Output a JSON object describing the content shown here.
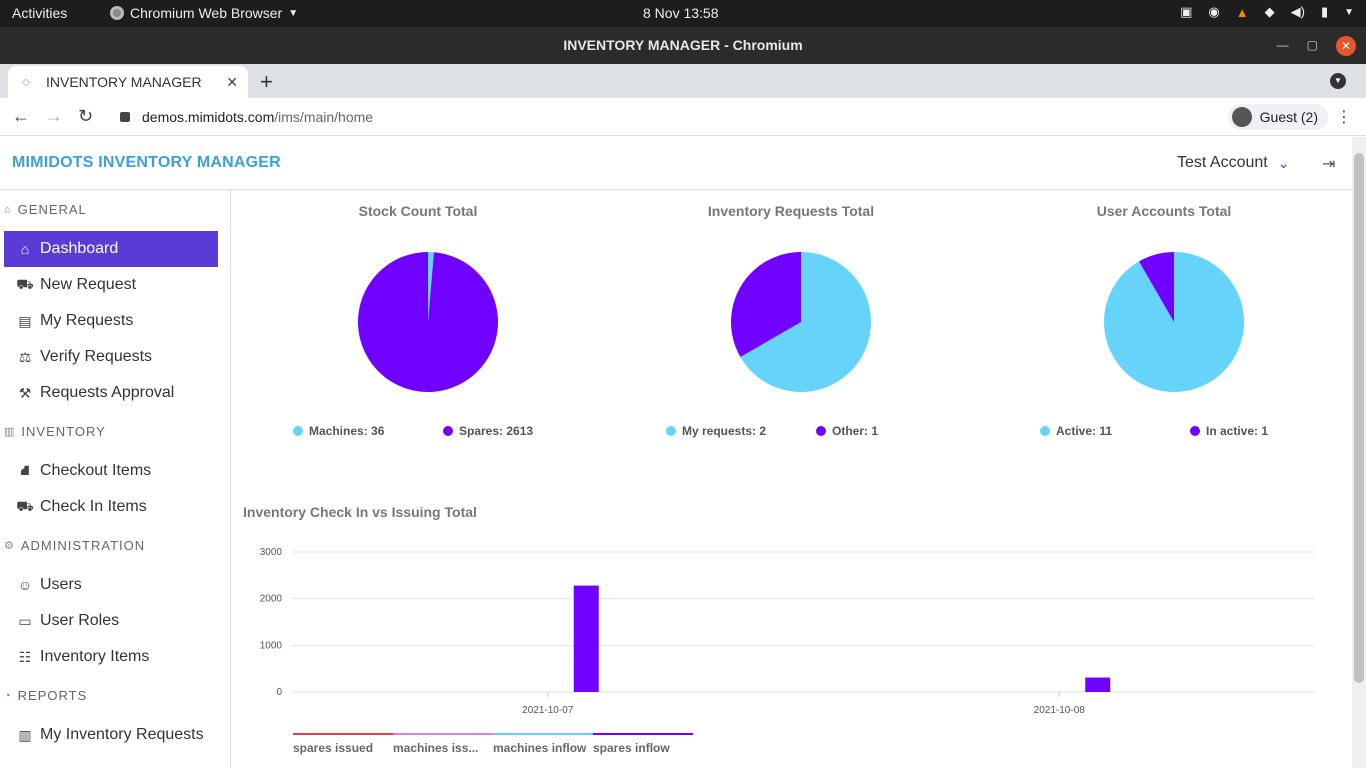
{
  "os": {
    "activities": "Activities",
    "app_name": "Chromium Web Browser",
    "clock": "8 Nov  13:58"
  },
  "window": {
    "title": "INVENTORY MANAGER - Chromium"
  },
  "browser": {
    "tab_title": "INVENTORY MANAGER",
    "url_host": "demos.mimidots.com",
    "url_path": "/ims/main/home",
    "profile": "Guest (2)"
  },
  "app": {
    "brand": "MIMIDOTS INVENTORY MANAGER",
    "account": "Test Account"
  },
  "sidebar": {
    "sections": [
      {
        "label": "GENERAL",
        "icon": "bank-icon"
      },
      {
        "label": "INVENTORY",
        "icon": "warehouse-icon"
      },
      {
        "label": "ADMINISTRATION",
        "icon": "gears-icon"
      },
      {
        "label": "REPORTS",
        "icon": "pie-icon"
      }
    ],
    "items": [
      {
        "label": "Dashboard",
        "icon": "home-icon",
        "active": true
      },
      {
        "label": "New Request",
        "icon": "cart-icon"
      },
      {
        "label": "My Requests",
        "icon": "archive-icon"
      },
      {
        "label": "Verify Requests",
        "icon": "scale-icon"
      },
      {
        "label": "Requests Approval",
        "icon": "gavel-icon"
      },
      {
        "label": "Checkout Items",
        "icon": "dolly-icon"
      },
      {
        "label": "Check In Items",
        "icon": "cart-flatbed-icon"
      },
      {
        "label": "Users",
        "icon": "users-icon"
      },
      {
        "label": "User Roles",
        "icon": "window-icon"
      },
      {
        "label": "Inventory Items",
        "icon": "list-icon"
      },
      {
        "label": "My Inventory Requests",
        "icon": "barcode-icon"
      }
    ]
  },
  "colors": {
    "accent": "#5a3bd6",
    "light_blue": "#66d3fa",
    "purple": "#7000ff",
    "red": "#e04050",
    "pink": "#e07ee0"
  },
  "chart_data": [
    {
      "type": "pie",
      "title": "Stock Count Total",
      "slices": [
        {
          "label": "Machines: 36",
          "value": 36,
          "color": "#66d3fa"
        },
        {
          "label": "Spares: 2613",
          "value": 2613,
          "color": "#7000ff"
        }
      ]
    },
    {
      "type": "pie",
      "title": "Inventory Requests Total",
      "slices": [
        {
          "label": "My requests: 2",
          "value": 2,
          "color": "#66d3fa"
        },
        {
          "label": "Other: 1",
          "value": 1,
          "color": "#7000ff"
        }
      ]
    },
    {
      "type": "pie",
      "title": "User Accounts Total",
      "slices": [
        {
          "label": "Active: 11",
          "value": 11,
          "color": "#66d3fa"
        },
        {
          "label": "In active: 1",
          "value": 1,
          "color": "#7000ff"
        }
      ]
    },
    {
      "type": "bar",
      "title": "Inventory Check In vs Issuing Total",
      "categories": [
        "2021-10-07",
        "2021-10-08"
      ],
      "yticks": [
        "0",
        "1000",
        "2000",
        "3000"
      ],
      "ylim": [
        0,
        3000
      ],
      "grid": true,
      "series": [
        {
          "name": "spares issued",
          "label": "spares issued",
          "color": "#e04050",
          "values": [
            0,
            0
          ]
        },
        {
          "name": "machines issued",
          "label": "machines iss...",
          "color": "#e07ee0",
          "values": [
            0,
            0
          ]
        },
        {
          "name": "machines inflow",
          "label": "machines inflow",
          "color": "#66d3fa",
          "values": [
            0,
            0
          ]
        },
        {
          "name": "spares inflow",
          "label": "spares inflow",
          "color": "#7000ff",
          "values": [
            2280,
            310
          ]
        }
      ]
    }
  ]
}
